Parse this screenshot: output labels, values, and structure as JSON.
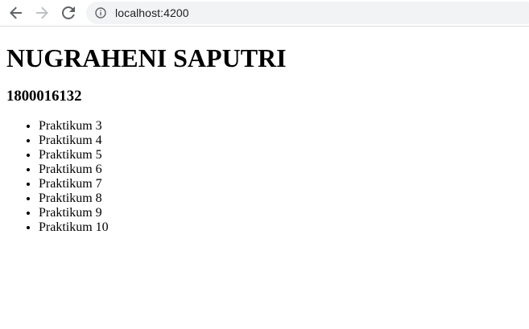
{
  "browser": {
    "url": "localhost:4200",
    "icons": {
      "back": "arrow-left-icon",
      "forward": "arrow-right-icon",
      "reload": "reload-icon",
      "info": "info-icon"
    }
  },
  "page": {
    "name": "NUGRAHENI SAPUTRI",
    "student_id": "1800016132",
    "items": [
      "Praktikum 3",
      "Praktikum 4",
      "Praktikum 5",
      "Praktikum 6",
      "Praktikum 7",
      "Praktikum 8",
      "Praktikum 9",
      "Praktikum 10"
    ]
  }
}
